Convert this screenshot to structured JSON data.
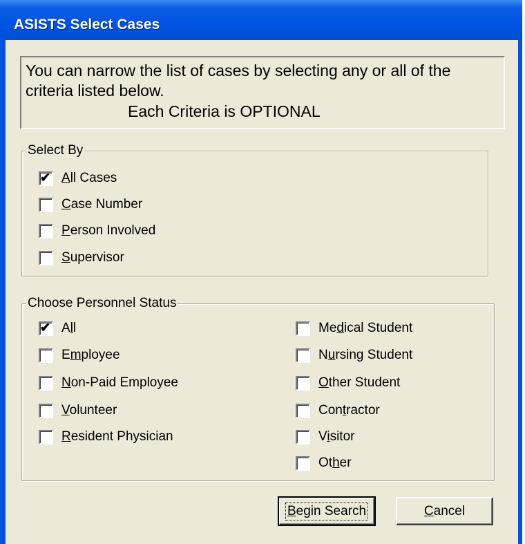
{
  "window": {
    "title": "ASISTS Select Cases"
  },
  "info": {
    "line1": "You can narrow the list of cases by selecting any or all of the",
    "line2": "criteria listed below.",
    "line3": "Each Criteria is OPTIONAL"
  },
  "select_by": {
    "legend": "Select By",
    "items": [
      {
        "pre": "",
        "key": "A",
        "post": "ll Cases",
        "checked": true
      },
      {
        "pre": "",
        "key": "C",
        "post": "ase Number",
        "checked": false
      },
      {
        "pre": "",
        "key": "P",
        "post": "erson Involved",
        "checked": false
      },
      {
        "pre": "",
        "key": "S",
        "post": "upervisor",
        "checked": false
      }
    ]
  },
  "personnel_status": {
    "legend": "Choose Personnel Status",
    "left": [
      {
        "pre": "A",
        "key": "l",
        "post": "l",
        "checked": true
      },
      {
        "pre": "E",
        "key": "m",
        "post": "ployee",
        "checked": false
      },
      {
        "pre": "",
        "key": "N",
        "post": "on-Paid Employee",
        "checked": false
      },
      {
        "pre": "",
        "key": "V",
        "post": "olunteer",
        "checked": false
      },
      {
        "pre": "",
        "key": "R",
        "post": "esident Physician",
        "checked": false
      }
    ],
    "right": [
      {
        "pre": "Me",
        "key": "d",
        "post": "ical Student",
        "checked": false
      },
      {
        "pre": "N",
        "key": "u",
        "post": "rsing Student",
        "checked": false
      },
      {
        "pre": "",
        "key": "O",
        "post": "ther Student",
        "checked": false
      },
      {
        "pre": "Con",
        "key": "t",
        "post": "ractor",
        "checked": false
      },
      {
        "pre": "V",
        "key": "i",
        "post": "sitor",
        "checked": false
      },
      {
        "pre": "Ot",
        "key": "h",
        "post": "er",
        "checked": false
      }
    ]
  },
  "buttons": {
    "begin": {
      "key": "B",
      "post": "egin Search"
    },
    "cancel": {
      "key": "C",
      "post": "ancel"
    }
  },
  "colors": {
    "titlebar": "#0054e3",
    "face": "#ece9d8"
  },
  "icons": {
    "check": "✔"
  }
}
